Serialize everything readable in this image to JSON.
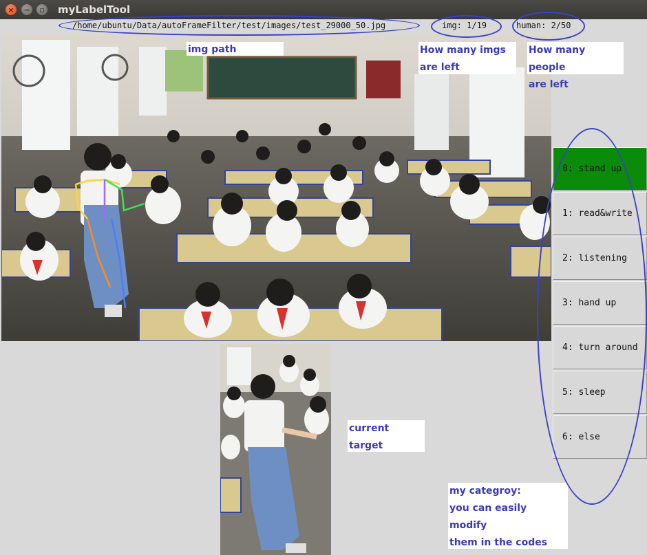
{
  "window": {
    "title": "myLabelTool",
    "close_glyph": "×",
    "min_glyph": "−",
    "max_glyph": "▫"
  },
  "info": {
    "path": "/home/ubuntu/Data/autoFrameFilter/test/images/test_29000_50.jpg",
    "img_counter": "img: 1/19",
    "human_counter": "human: 2/50"
  },
  "notes": {
    "img_path": "img path",
    "imgs_left": [
      "How many imgs",
      "are left"
    ],
    "people_left": [
      "How many people",
      "are left"
    ],
    "current_target": "current target",
    "category": [
      "my categroy:",
      "you can easily modify",
      "them in the codes"
    ]
  },
  "categories": [
    {
      "label": "0: stand up",
      "active": true
    },
    {
      "label": "1: read&write",
      "active": false
    },
    {
      "label": "2: listening",
      "active": false
    },
    {
      "label": "3: hand up",
      "active": false
    },
    {
      "label": "4: turn around",
      "active": false
    },
    {
      "label": "5: sleep",
      "active": false
    },
    {
      "label": "6: else",
      "active": false
    }
  ],
  "colors": {
    "annotation": "#3a40c8",
    "active_category": "#0a8c0a",
    "skeleton_left": "#ffd040",
    "skeleton_right": "#40e060",
    "skeleton_leg": "#ff8a1c"
  },
  "icons": {
    "close": "close-icon",
    "minimize": "minimize-icon",
    "maximize": "maximize-icon"
  }
}
